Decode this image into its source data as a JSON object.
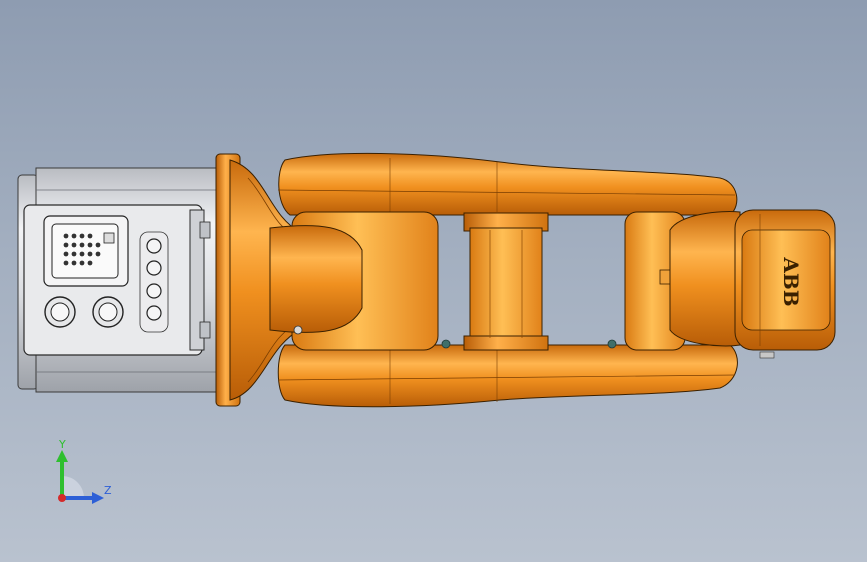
{
  "viewport": {
    "brand_mark": "ABB",
    "triad": {
      "y_label": "Y",
      "z_label": "Z",
      "colors": {
        "y": "#2fbf2f",
        "z": "#2d5fd6",
        "x": "#d42a2a"
      }
    }
  },
  "colors": {
    "background_top": "#8e9cb1",
    "background_bottom": "#b9c2cf",
    "robot_orange": "#e98a1f",
    "robot_highlight": "#ffb14a",
    "robot_shadow": "#b35c08",
    "base_metal": "#d6d8dc",
    "outline": "#2a2a2a"
  }
}
